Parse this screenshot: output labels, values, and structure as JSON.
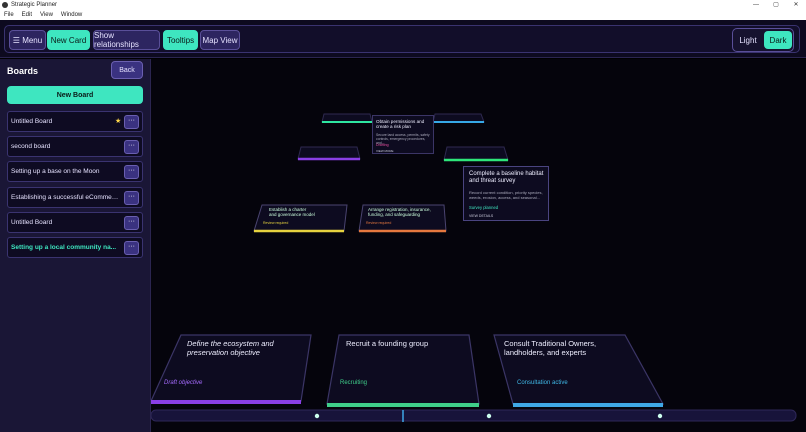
{
  "window": {
    "title": "Strategic Planner",
    "controls": [
      "—",
      "▢",
      "✕"
    ]
  },
  "menu": [
    "File",
    "Edit",
    "View",
    "Window"
  ],
  "toolbar": {
    "menu_label": "☰ Menu",
    "new_card": "New Card",
    "show_relationships": "Show relationships",
    "tooltips": "Tooltips",
    "map_view": "Map View",
    "light": "Light",
    "dark": "Dark"
  },
  "sidebar": {
    "title": "Boards",
    "back": "Back",
    "new_board": "New Board",
    "more_label": "···",
    "boards": [
      {
        "label": "Untitled Board",
        "starred": true
      },
      {
        "label": "second board"
      },
      {
        "label": "Setting up a base on the Moon"
      },
      {
        "label": "Establishing a successful eCommer..."
      },
      {
        "label": "Untitled Board"
      },
      {
        "label": "Setting up a local community na...",
        "active": true
      }
    ]
  },
  "cards": {
    "far_top_center": {
      "title": "Obtain permissions and create a risk plan",
      "body": "Secure land access, permits, safety controls, emergency procedures, and...",
      "status": "Drafting",
      "more": "VIEW MORE"
    },
    "right_survey": {
      "title": "Complete a baseline habitat and threat survey",
      "body": "Record current condition, priority species, weeds, erosion, access, and seasonal...",
      "status": "Survey planned",
      "more": "VIEW DETAILS"
    },
    "mid_left": {
      "title": "Establish a charter and governance model",
      "status": "Review required"
    },
    "mid_center": {
      "title": "Arrange registration, insurance, funding, and safeguarding",
      "status": "Review required"
    },
    "front": [
      {
        "title": "Define the ecosystem and preservation objective",
        "status": "Draft objective",
        "color": "#8a3fe6"
      },
      {
        "title": "Recruit a founding group",
        "status": "Recruiting",
        "color": "#3fcf8a"
      },
      {
        "title": "Consult Traditional Owners, landholders, and experts",
        "status": "Consultation active",
        "color": "#3fa8e6"
      }
    ]
  },
  "colors": {
    "accent": "#3ee6c0",
    "panel": "#1a1636",
    "canvas": "#05040c"
  }
}
